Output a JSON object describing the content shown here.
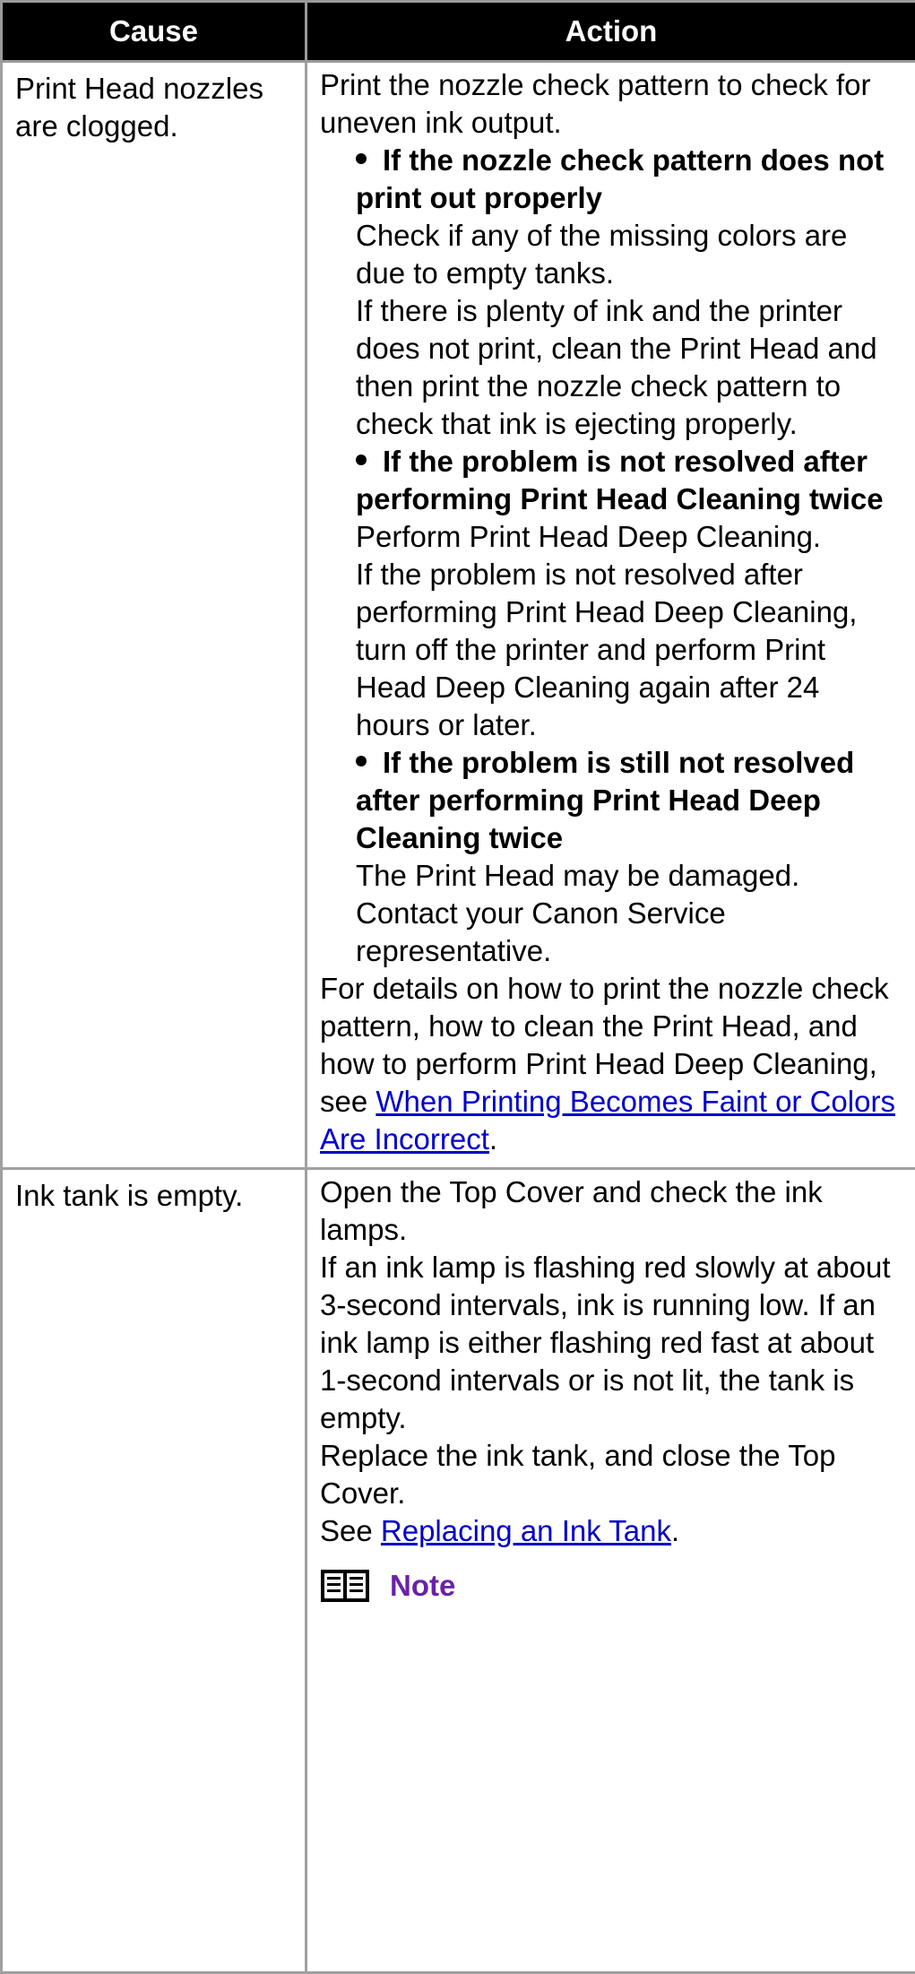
{
  "header": {
    "cause": "Cause",
    "action": "Action"
  },
  "row1": {
    "cause": "Print Head nozzles are clogged.",
    "intro": "Print the nozzle check pattern to check for uneven ink output.",
    "items": [
      {
        "title": "If the nozzle check pattern does not print out properly",
        "lines": [
          "Check if any of the missing colors are due to empty tanks.",
          "If there is plenty of ink and the printer does not print, clean the Print Head and then print the nozzle check pattern to check that ink is ejecting properly."
        ]
      },
      {
        "title": "If the problem is not resolved after performing Print Head Cleaning twice",
        "lines": [
          "Perform Print Head Deep Cleaning.",
          "If the problem is not resolved after performing Print Head Deep Cleaning, turn off the printer and perform Print Head Deep Cleaning again after 24 hours or later."
        ]
      },
      {
        "title": "If the problem is still not resolved after performing Print Head Deep Cleaning twice",
        "lines": [
          "The Print Head may be damaged. Contact your Canon Service representative."
        ]
      }
    ],
    "details_prefix": "For details on how to print the nozzle check pattern, how to clean the Print Head, and how to perform Print Head Deep Cleaning, see ",
    "details_link": "When Printing Becomes Faint or Colors Are Incorrect",
    "details_suffix": "."
  },
  "row2": {
    "cause": "Ink tank is empty.",
    "lines": [
      "Open the Top Cover and check the ink lamps.",
      "If an ink lamp is flashing red slowly at about 3-second intervals, ink is running low. If an ink lamp is either flashing red fast at about 1-second intervals or is not lit, the tank is empty.",
      "Replace the ink tank, and close the Top Cover."
    ],
    "see_prefix": "See ",
    "see_link": "Replacing an Ink Tank",
    "see_suffix": ".",
    "note_label": "Note",
    "note_icon": "book-icon"
  }
}
